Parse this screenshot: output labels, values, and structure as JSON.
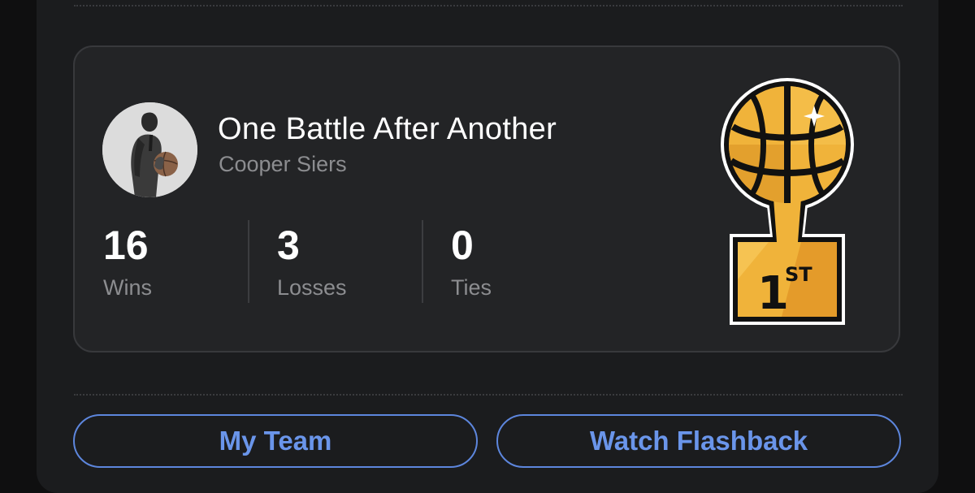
{
  "card": {
    "team_name": "One Battle After Another",
    "owner_name": "Cooper Siers"
  },
  "record": {
    "wins": {
      "value": "16",
      "label": "Wins"
    },
    "losses": {
      "value": "3",
      "label": "Losses"
    },
    "ties": {
      "value": "0",
      "label": "Ties"
    }
  },
  "trophy": {
    "icon": "basketball-trophy-icon",
    "rank_main": "1",
    "rank_suffix": "ST"
  },
  "buttons": {
    "my_team": "My Team",
    "watch_flashback": "Watch Flashback"
  },
  "colors": {
    "accent": "#5d86dd",
    "trophy_gold": "#f0b33a",
    "panel": "#1b1c1e",
    "card": "#232426"
  }
}
